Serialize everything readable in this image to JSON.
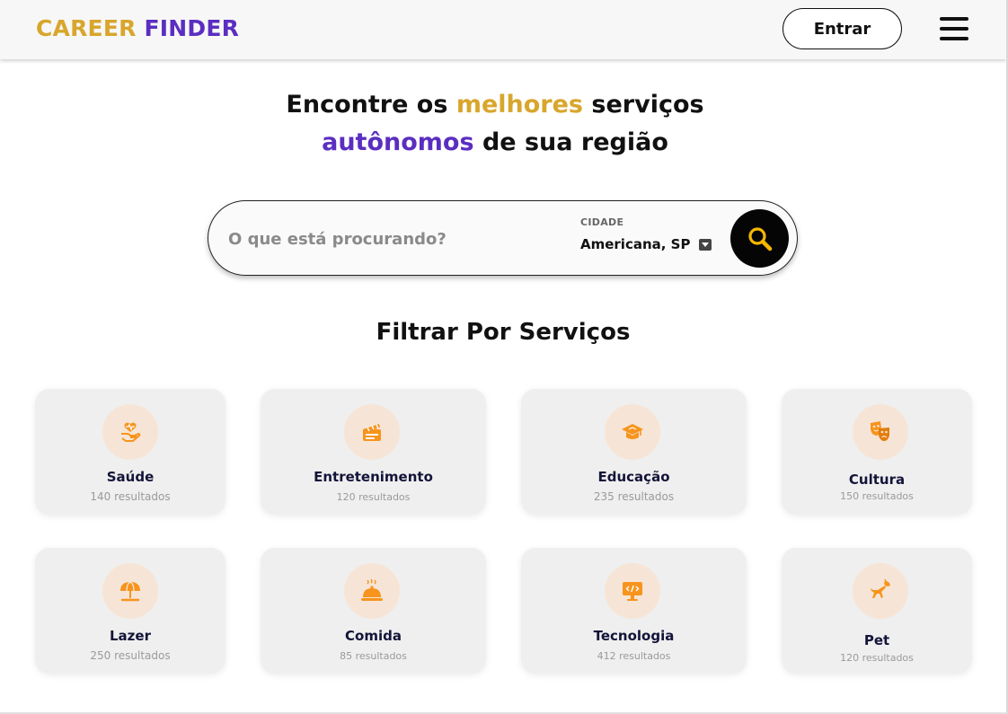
{
  "header": {
    "brand_part1": "CAREER",
    "brand_part2": "FINDER",
    "login_label": "Entrar"
  },
  "hero": {
    "line1_before": "Encontre os ",
    "line1_highlight": "melhores",
    "line1_after": " serviços",
    "line2_highlight": "autônomos",
    "line2_after": " de sua região"
  },
  "search": {
    "placeholder": "O que está procurando?",
    "value": "",
    "city_label": "CIDADE",
    "city_value": "Americana, SP"
  },
  "filters": {
    "title": "Filtrar Por Serviços",
    "categories": [
      {
        "name": "Saúde",
        "count": "140 resultados",
        "icon": "heart-hand-icon"
      },
      {
        "name": "Entretenimento",
        "count": "120 resultados",
        "icon": "clapperboard-icon"
      },
      {
        "name": "Educação",
        "count": "235 resultados",
        "icon": "graduation-cap-icon"
      },
      {
        "name": "Cultura",
        "count": "150 resultados",
        "icon": "theater-masks-icon"
      },
      {
        "name": "Lazer",
        "count": "250 resultados",
        "icon": "beach-umbrella-icon"
      },
      {
        "name": "Comida",
        "count": "85 resultados",
        "icon": "food-cloche-icon"
      },
      {
        "name": "Tecnologia",
        "count": "412 resultados",
        "icon": "code-monitor-icon"
      },
      {
        "name": "Pet",
        "count": "120 resultados",
        "icon": "dog-icon"
      }
    ]
  },
  "colors": {
    "gold": "#d8a62c",
    "purple": "#5b2ec1",
    "icon_orange": "#f7941d",
    "icon_bg": "#f6e5d6",
    "card_bg": "#efefef"
  }
}
